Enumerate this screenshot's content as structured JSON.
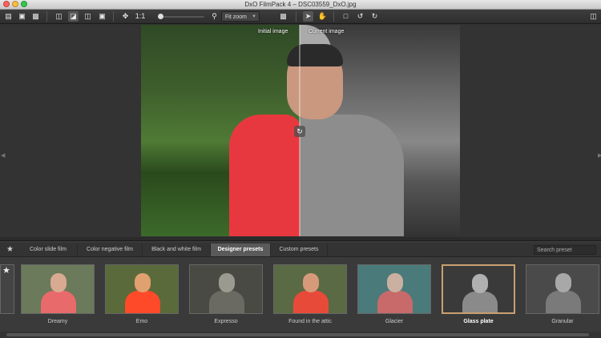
{
  "window": {
    "title": "DxO FilmPack 4 – DSC03559_DxO.jpg"
  },
  "toolbar": {
    "zoom_ratio": "1:1",
    "zoom_select": "Fit zoom",
    "icons": [
      "folder-icon",
      "save-icon",
      "print-icon",
      "single-view-icon",
      "split-view-icon",
      "side-by-side-icon",
      "compare-icon",
      "move-icon",
      "zoom-icon",
      "display-icon",
      "pointer-icon",
      "hand-icon",
      "crop-icon",
      "rotate-left-icon",
      "rotate-right-icon",
      "panel-toggle-icon"
    ]
  },
  "viewer": {
    "label_left": "Initial image",
    "label_right": "Current image"
  },
  "tabs": [
    {
      "label": "Color slide film"
    },
    {
      "label": "Color negative film"
    },
    {
      "label": "Black and white film"
    },
    {
      "label": "Designer presets"
    },
    {
      "label": "Custom presets"
    }
  ],
  "active_tab": "Designer presets",
  "search": {
    "placeholder": "Search preset"
  },
  "presets": [
    {
      "label": "Dreamy",
      "bg": "#6a7a5a",
      "shirt": "#e86a6a",
      "face": "#d8aa92"
    },
    {
      "label": "Emo",
      "bg": "#5a6a3a",
      "shirt": "#ff4a2a",
      "face": "#e0a070"
    },
    {
      "label": "Expresso",
      "bg": "#4a4a44",
      "shirt": "#6a6a62",
      "face": "#9a9a90"
    },
    {
      "label": "Found in the attic",
      "bg": "#5a6a44",
      "shirt": "#e84a3a",
      "face": "#d69a7a"
    },
    {
      "label": "Glacier",
      "bg": "#4a7a7a",
      "shirt": "#c86a6a",
      "face": "#c9b0a0"
    },
    {
      "label": "Glass plate",
      "bg": "#3a3a3a",
      "shirt": "#8a8a8a",
      "face": "#b0b0b0"
    },
    {
      "label": "Granular",
      "bg": "#4a4a4a",
      "shirt": "#7a7a7a",
      "face": "#a8a8a8"
    }
  ],
  "selected_preset": "Glass plate",
  "colors": {
    "selection": "#c9a070",
    "shirt_red": "#e8383f"
  }
}
